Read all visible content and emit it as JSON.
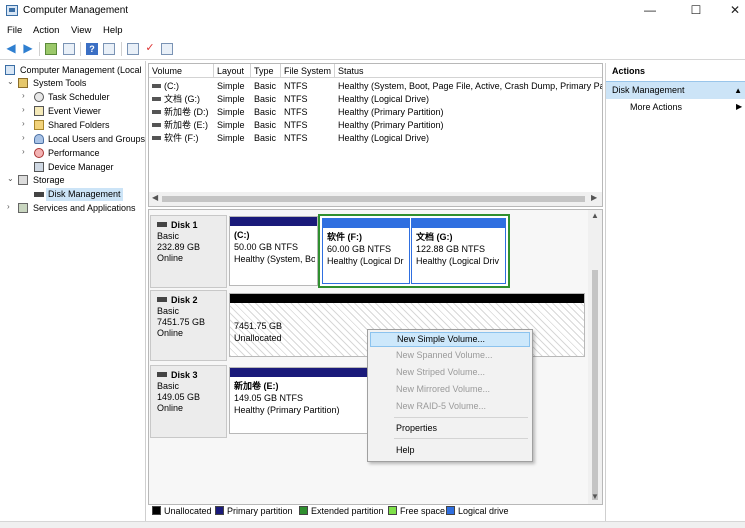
{
  "window": {
    "title": "Computer Management",
    "minimize": "—",
    "maximize": "☐",
    "close": "✕"
  },
  "menu": [
    "File",
    "Action",
    "View",
    "Help"
  ],
  "toolbar": {
    "help_glyph": "?",
    "check_glyph": "✓"
  },
  "tree": {
    "items": [
      {
        "label": "Computer Management (Local",
        "arrow": "",
        "icon": "computer-icon"
      },
      {
        "label": "System Tools",
        "arrow": "⌄",
        "icon": "tools-icon"
      },
      {
        "label": "Task Scheduler",
        "arrow": "›",
        "icon": "clock-icon"
      },
      {
        "label": "Event Viewer",
        "arrow": "›",
        "icon": "log-icon"
      },
      {
        "label": "Shared Folders",
        "arrow": "›",
        "icon": "folder-icon"
      },
      {
        "label": "Local Users and Groups",
        "arrow": "›",
        "icon": "users-icon"
      },
      {
        "label": "Performance",
        "arrow": "›",
        "icon": "performance-icon"
      },
      {
        "label": "Device Manager",
        "arrow": "",
        "icon": "device-icon"
      },
      {
        "label": "Storage",
        "arrow": "⌄",
        "icon": "storage-icon"
      },
      {
        "label": "Disk Management",
        "arrow": "",
        "icon": "disk-icon"
      },
      {
        "label": "Services and Applications",
        "arrow": "›",
        "icon": "services-icon"
      }
    ]
  },
  "volumes": {
    "columns": [
      "Volume",
      "Layout",
      "Type",
      "File System",
      "Status"
    ],
    "rows": [
      [
        "(C:)",
        "Simple",
        "Basic",
        "NTFS",
        "Healthy (System, Boot, Page File, Active, Crash Dump, Primary Pa"
      ],
      [
        "文档 (G:)",
        "Simple",
        "Basic",
        "NTFS",
        "Healthy (Logical Drive)"
      ],
      [
        "新加卷 (D:)",
        "Simple",
        "Basic",
        "NTFS",
        "Healthy (Primary Partition)"
      ],
      [
        "新加卷 (E:)",
        "Simple",
        "Basic",
        "NTFS",
        "Healthy (Primary Partition)"
      ],
      [
        "软件 (F:)",
        "Simple",
        "Basic",
        "NTFS",
        "Healthy (Logical Drive)"
      ]
    ]
  },
  "disks": [
    {
      "name": "Disk 1",
      "type": "Basic",
      "size": "232.89 GB",
      "state": "Online"
    },
    {
      "name": "Disk 2",
      "type": "Basic",
      "size": "7451.75 GB",
      "state": "Online"
    },
    {
      "name": "Disk 3",
      "type": "Basic",
      "size": "149.05 GB",
      "state": "Online"
    }
  ],
  "partitions": {
    "d1_c": {
      "name": "(C:)",
      "size": "50.00 GB NTFS",
      "status": "Healthy (System, Bo"
    },
    "d1_f": {
      "name": "软件 (F:)",
      "size": "60.00 GB NTFS",
      "status": "Healthy (Logical Dr"
    },
    "d1_g": {
      "name": "文档 (G:)",
      "size": "122.88 GB NTFS",
      "status": "Healthy (Logical Driv"
    },
    "d2_un": {
      "size": "7451.75 GB",
      "status": "Unallocated"
    },
    "d3_e": {
      "name": "新加卷 (E:)",
      "size": "149.05 GB NTFS",
      "status": "Healthy (Primary Partition)"
    }
  },
  "legend": [
    {
      "label": "Unallocated",
      "color": "#000000"
    },
    {
      "label": "Primary partition",
      "color": "#1a1a7a"
    },
    {
      "label": "Extended partition",
      "color": "#2f8f2f"
    },
    {
      "label": "Free space",
      "color": "#7fe04a"
    },
    {
      "label": "Logical drive",
      "color": "#2f6fe0"
    }
  ],
  "actions": {
    "title": "Actions",
    "section": "Disk Management",
    "more": "More Actions",
    "more_arrow": "▶",
    "section_arrow": "▲"
  },
  "context_menu": {
    "items": [
      {
        "label": "New Simple Volume...",
        "enabled": true
      },
      {
        "label": "New Spanned Volume...",
        "enabled": false
      },
      {
        "label": "New Striped Volume...",
        "enabled": false
      },
      {
        "label": "New Mirrored Volume...",
        "enabled": false
      },
      {
        "label": "New RAID-5 Volume...",
        "enabled": false
      },
      {
        "label": "Properties",
        "enabled": true
      },
      {
        "label": "Help",
        "enabled": true
      }
    ]
  },
  "colors": {
    "primary": "#1a1a7a",
    "logical": "#2f6fe0",
    "extended": "#2f8f2f",
    "selection": "#cce4f7"
  }
}
